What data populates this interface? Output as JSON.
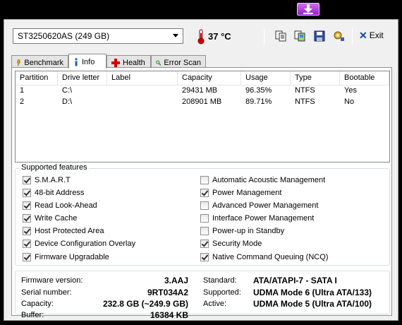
{
  "drive_select": {
    "value": "ST3250620AS (249 GB)"
  },
  "temperature": "37 °C",
  "toolbar": {
    "exit_label": "Exit",
    "icons": [
      "copy-text-icon",
      "copy-screenshot-icon",
      "save-icon",
      "options-icon"
    ]
  },
  "tabs": [
    {
      "label": "Benchmark",
      "icon": "benchmark-icon"
    },
    {
      "label": "Info",
      "icon": "info-icon"
    },
    {
      "label": "Health",
      "icon": "health-icon"
    },
    {
      "label": "Error Scan",
      "icon": "error-scan-icon"
    }
  ],
  "partitions": {
    "columns": [
      "Partition",
      "Drive letter",
      "Label",
      "Capacity",
      "Usage",
      "Type",
      "Bootable"
    ],
    "rows": [
      [
        "1",
        "C:\\",
        "",
        "29431 MB",
        "96.35%",
        "NTFS",
        "Yes"
      ],
      [
        "2",
        "D:\\",
        "",
        "208901 MB",
        "89.71%",
        "NTFS",
        "No"
      ]
    ]
  },
  "features": {
    "title": "Supported features",
    "left": [
      {
        "label": "S.M.A.R.T",
        "checked": true
      },
      {
        "label": "48-bit Address",
        "checked": true
      },
      {
        "label": "Read Look-Ahead",
        "checked": true
      },
      {
        "label": "Write Cache",
        "checked": true
      },
      {
        "label": "Host Protected Area",
        "checked": true
      },
      {
        "label": "Device Configuration Overlay",
        "checked": true
      },
      {
        "label": "Firmware Upgradable",
        "checked": true
      }
    ],
    "right": [
      {
        "label": "Automatic Acoustic Management",
        "checked": false
      },
      {
        "label": "Power Management",
        "checked": true
      },
      {
        "label": "Advanced Power Management",
        "checked": false
      },
      {
        "label": "Interface Power Management",
        "checked": false
      },
      {
        "label": "Power-up in Standby",
        "checked": false
      },
      {
        "label": "Security Mode",
        "checked": true
      },
      {
        "label": "Native Command Queuing (NCQ)",
        "checked": true
      }
    ]
  },
  "info": {
    "firmware_label": "Firmware version:",
    "firmware": "3.AAJ",
    "serial_label": "Serial number:",
    "serial": "9RT034A2",
    "capacity_label": "Capacity:",
    "capacity": "232.8 GB (~249.9 GB)",
    "buffer_label": "Buffer:",
    "buffer": "16384 KB",
    "standard_label": "Standard:",
    "standard": "ATA/ATAPI-7 - SATA I",
    "supported_label": "Supported:",
    "supported": "UDMA Mode 6 (Ultra ATA/133)",
    "active_label": "Active:",
    "active": "UDMA Mode 5 (Ultra ATA/100)"
  }
}
